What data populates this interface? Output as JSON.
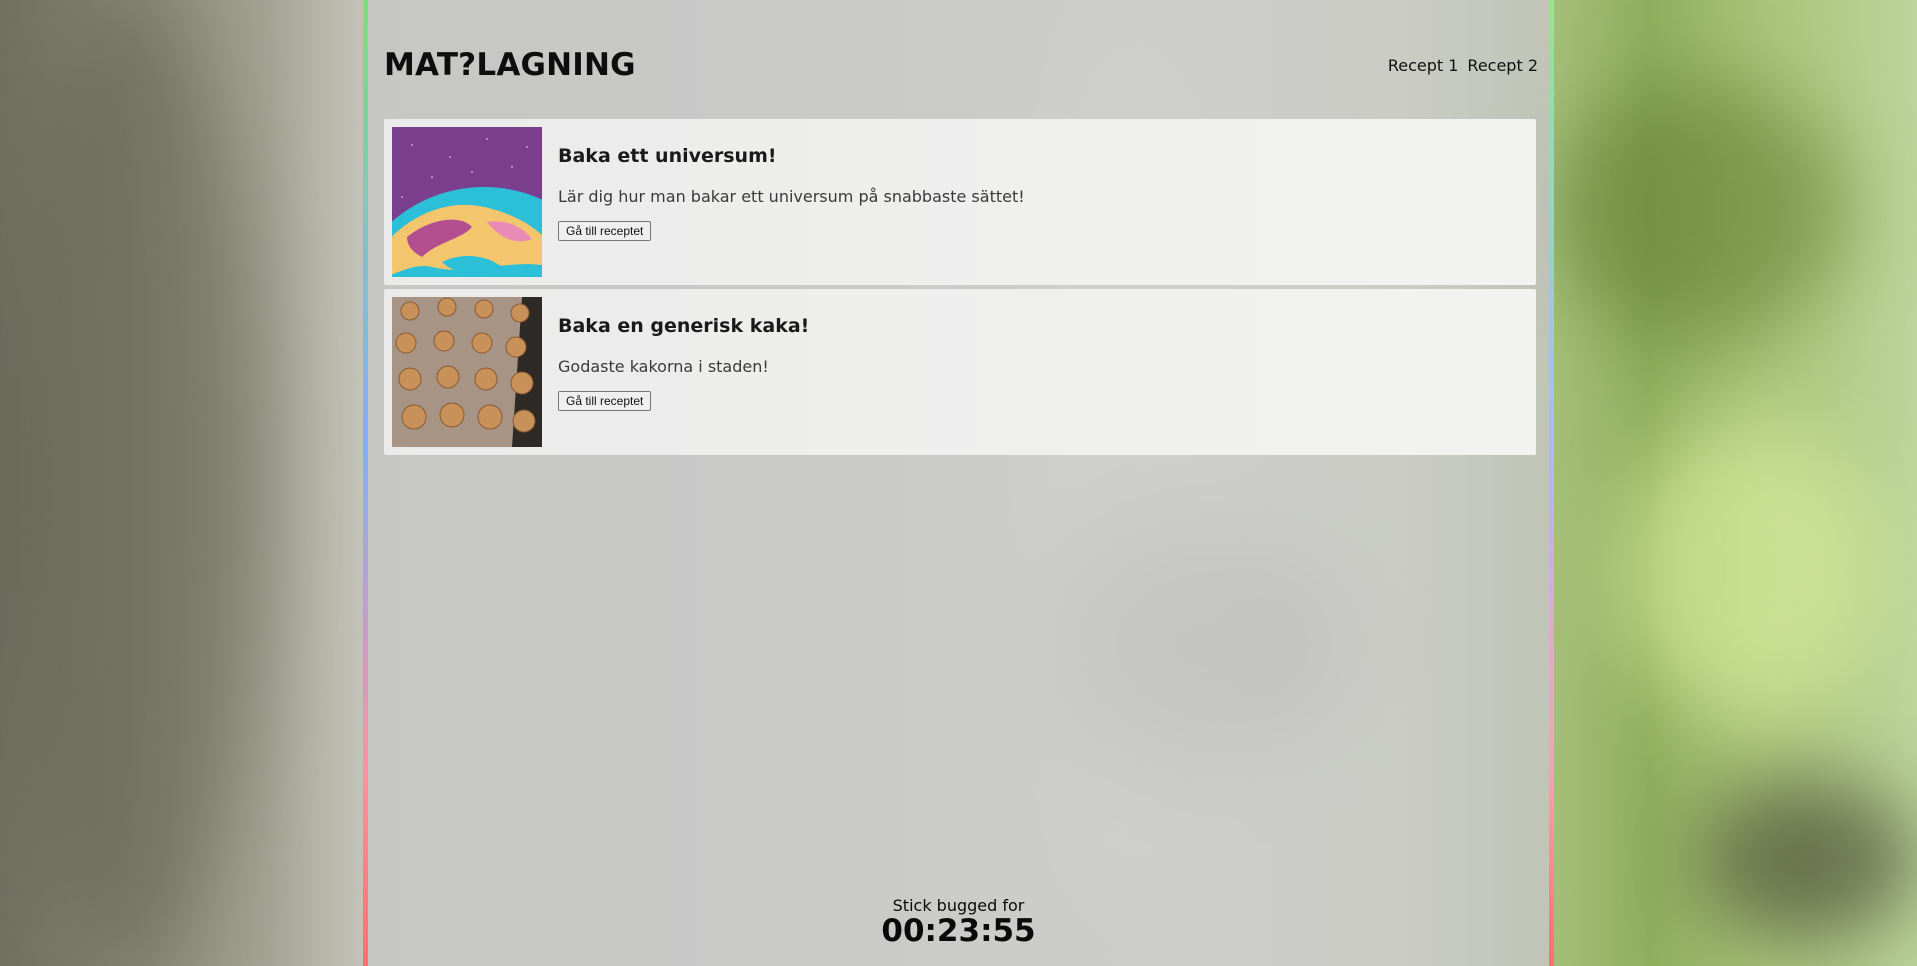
{
  "header": {
    "logo": "MAT?LAGNING",
    "nav": [
      "Recept 1",
      "Recept 2"
    ]
  },
  "recipes": [
    {
      "title": "Baka ett universum!",
      "description": "Lär dig hur man bakar ett universum på snabbaste sättet!",
      "button": "Gå till receptet"
    },
    {
      "title": "Baka en generisk kaka!",
      "description": "Godaste kakorna i staden!",
      "button": "Gå till receptet"
    }
  ],
  "timer": {
    "label": "Stick bugged for",
    "time": "00:23:55"
  },
  "colors": {
    "accent_green": "#7de07d",
    "accent_blue": "#7db0ff",
    "accent_red": "#ff6f6f"
  }
}
